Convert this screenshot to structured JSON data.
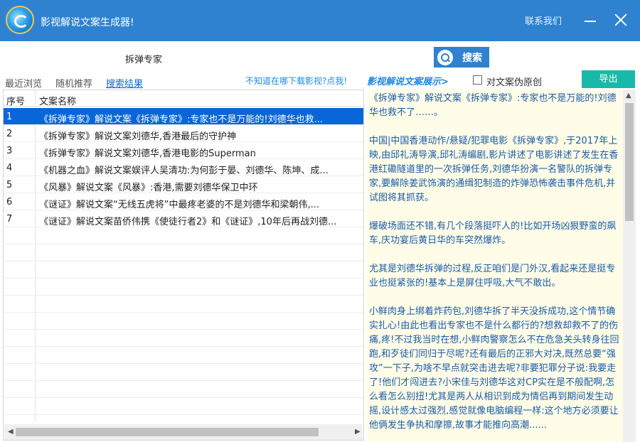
{
  "window": {
    "title": "影视解说文案生成器!",
    "contact": "联系我们"
  },
  "search": {
    "value": "拆弹专家",
    "button_label": "搜索"
  },
  "tabs": [
    "最近浏览",
    "随机推荐",
    "搜索结果"
  ],
  "links": {
    "download": "不知道在哪下载影视?点我!",
    "showcase": "影视解说文案展示>"
  },
  "options": {
    "pseudo_original_label": "对文案伪原创",
    "export_label": "导出"
  },
  "table": {
    "columns": [
      "序号",
      "文案名称"
    ],
    "rows": [
      {
        "num": "1",
        "title": "《拆弹专家》解说文案《拆弹专家》:专家也不是万能的!刘德华也救..."
      },
      {
        "num": "2",
        "title": "《拆弹专家》解说文案刘德华,香港最后的守护神"
      },
      {
        "num": "3",
        "title": "《拆弹专家》解说文案刘德华,香港电影的Superman"
      },
      {
        "num": "4",
        "title": "《机器之血》解说文案娱评人吴清功:为何彭于晏、刘德华、陈坤、成..."
      },
      {
        "num": "5",
        "title": "《风暴》解说文案《风暴》:香港,需要刘德华保卫中环"
      },
      {
        "num": "6",
        "title": "《谜证》解说文案“无线五虎将”中最疼老婆的不是刘德华和梁朝伟,..."
      },
      {
        "num": "7",
        "title": "《谜证》解说文案苗侨伟携《使徒行者2》和《谜证》,10年后再战刘德..."
      }
    ]
  },
  "preview": {
    "text": "《拆弹专家》解说文案《拆弹专家》:专家也不是万能的!刘德华也救不了……。\n\n中国|中国香港动作/悬疑/犯罪电影《拆弹专家》,于2017年上映,由邱礼涛导演,邱礼涛编剧,影片讲述了电影讲述了发生在香港红磡隧道里的一次拆弹任务,刘德华扮演一名警队的拆弹专家,要解除姜武饰演的通缉犯制造的炸弹恐怖袭击事件危机,并试图将其抓获。\n\n爆破场面还不错,有几个段落挺吓人的!比如开场凶狠野蛮的飙车,庆功宴后黄日华的车突然爆炸。\n\n尤其是刘德华拆弹的过程,反正咱们是门外汉,看起来还是挺专业也挺紧张的!基本上是屏住呼吸,大气不敢出。\n\n小鲜肉身上绑着炸药包,刘德华拆了半天没拆成功,这个情节确实扎心!由此也看出专家也不是什么都行的?想救却救不了的伤痛,疼!不过我当时在想,小鲜肉警察怎么不在危急关头转身往回跑,和歹徒们同归于尽呢?还有最后的正邪大对决,既然总要“强攻”一下子,为啥不早点就突击进去呢?非要犯罪分子说:我要走了!他们才闯进去?小宋佳与刘德华这对CP实在是不般配啊,怎么看怎么别扭!尤其是两人从相识到成为情侣再到期间发生动摇,设计感太过强烈,感觉就像电脑编程一样:这个地方必须要让他俩发生争执和摩擦,故事才能推向高潮......"
  }
}
